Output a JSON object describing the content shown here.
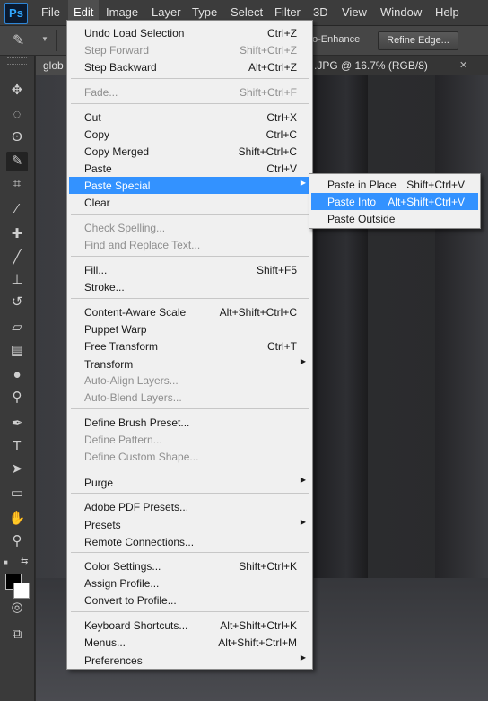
{
  "app": {
    "logo": "Ps"
  },
  "menubar": {
    "items": [
      {
        "label": "File"
      },
      {
        "label": "Edit"
      },
      {
        "label": "Image"
      },
      {
        "label": "Layer"
      },
      {
        "label": "Type"
      },
      {
        "label": "Select"
      },
      {
        "label": "Filter"
      },
      {
        "label": "3D"
      },
      {
        "label": "View"
      },
      {
        "label": "Window"
      },
      {
        "label": "Help"
      }
    ]
  },
  "options_bar": {
    "auto_enhance_label": "o-Enhance",
    "refine_edge_label": "Refine Edge..."
  },
  "tabs": {
    "left_label": "glob",
    "right_label": ".JPG @ 16.7% (RGB/8)",
    "close_glyph": "✕"
  },
  "edit_menu": {
    "items": [
      {
        "label": "Undo Load Selection",
        "shortcut": "Ctrl+Z"
      },
      {
        "label": "Step Forward",
        "shortcut": "Shift+Ctrl+Z",
        "disabled": true
      },
      {
        "label": "Step Backward",
        "shortcut": "Alt+Ctrl+Z"
      },
      {
        "label": "Fade...",
        "shortcut": "Shift+Ctrl+F",
        "disabled": true
      },
      {
        "label": "Cut",
        "shortcut": "Ctrl+X"
      },
      {
        "label": "Copy",
        "shortcut": "Ctrl+C"
      },
      {
        "label": "Copy Merged",
        "shortcut": "Shift+Ctrl+C"
      },
      {
        "label": "Paste",
        "shortcut": "Ctrl+V"
      },
      {
        "label": "Paste Special",
        "shortcut": "",
        "submenu": true,
        "highlighted": true
      },
      {
        "label": "Clear",
        "shortcut": ""
      },
      {
        "label": "Check Spelling...",
        "shortcut": "",
        "disabled": true
      },
      {
        "label": "Find and Replace Text...",
        "shortcut": "",
        "disabled": true
      },
      {
        "label": "Fill...",
        "shortcut": "Shift+F5"
      },
      {
        "label": "Stroke...",
        "shortcut": ""
      },
      {
        "label": "Content-Aware Scale",
        "shortcut": "Alt+Shift+Ctrl+C"
      },
      {
        "label": "Puppet Warp",
        "shortcut": ""
      },
      {
        "label": "Free Transform",
        "shortcut": "Ctrl+T"
      },
      {
        "label": "Transform",
        "shortcut": "",
        "submenu": true
      },
      {
        "label": "Auto-Align Layers...",
        "shortcut": "",
        "disabled": true
      },
      {
        "label": "Auto-Blend Layers...",
        "shortcut": "",
        "disabled": true
      },
      {
        "label": "Define Brush Preset...",
        "shortcut": ""
      },
      {
        "label": "Define Pattern...",
        "shortcut": "",
        "disabled": true
      },
      {
        "label": "Define Custom Shape...",
        "shortcut": "",
        "disabled": true
      },
      {
        "label": "Purge",
        "shortcut": "",
        "submenu": true
      },
      {
        "label": "Adobe PDF Presets...",
        "shortcut": ""
      },
      {
        "label": "Presets",
        "shortcut": "",
        "submenu": true
      },
      {
        "label": "Remote Connections...",
        "shortcut": ""
      },
      {
        "label": "Color Settings...",
        "shortcut": "Shift+Ctrl+K"
      },
      {
        "label": "Assign Profile...",
        "shortcut": ""
      },
      {
        "label": "Convert to Profile...",
        "shortcut": ""
      },
      {
        "label": "Keyboard Shortcuts...",
        "shortcut": "Alt+Shift+Ctrl+K"
      },
      {
        "label": "Menus...",
        "shortcut": "Alt+Shift+Ctrl+M"
      },
      {
        "label": "Preferences",
        "shortcut": "",
        "submenu": true
      }
    ]
  },
  "paste_special_menu": {
    "items": [
      {
        "label": "Paste in Place",
        "shortcut": "Shift+Ctrl+V"
      },
      {
        "label": "Paste Into",
        "shortcut": "Alt+Shift+Ctrl+V",
        "highlighted": true
      },
      {
        "label": "Paste Outside",
        "shortcut": ""
      }
    ]
  },
  "tools": [
    {
      "name": "move-tool-icon",
      "glyph": "✥"
    },
    {
      "name": "marquee-tool-icon",
      "glyph": "◌"
    },
    {
      "name": "lasso-tool-icon",
      "glyph": "ʘ"
    },
    {
      "name": "quick-selection-tool-icon",
      "glyph": "✎",
      "selected": true
    },
    {
      "name": "crop-tool-icon",
      "glyph": "⌗"
    },
    {
      "name": "eyedropper-tool-icon",
      "glyph": "⁄"
    },
    {
      "name": "healing-brush-tool-icon",
      "glyph": "✚"
    },
    {
      "name": "brush-tool-icon",
      "glyph": "╱"
    },
    {
      "name": "clone-stamp-tool-icon",
      "glyph": "⊥"
    },
    {
      "name": "history-brush-tool-icon",
      "glyph": "↺"
    },
    {
      "name": "eraser-tool-icon",
      "glyph": "▱"
    },
    {
      "name": "gradient-tool-icon",
      "glyph": "▤"
    },
    {
      "name": "blur-tool-icon",
      "glyph": "●"
    },
    {
      "name": "dodge-tool-icon",
      "glyph": "⚲"
    },
    {
      "name": "pen-tool-icon",
      "glyph": "✒"
    },
    {
      "name": "type-tool-icon",
      "glyph": "T"
    },
    {
      "name": "path-selection-tool-icon",
      "glyph": "➤"
    },
    {
      "name": "shape-tool-icon",
      "glyph": "▭"
    },
    {
      "name": "hand-tool-icon",
      "glyph": "✋"
    },
    {
      "name": "zoom-tool-icon",
      "glyph": "⚲"
    },
    {
      "name": "quick-mask-icon",
      "glyph": "◎"
    },
    {
      "name": "screen-mode-icon",
      "glyph": "⧉"
    }
  ],
  "colors": {
    "highlight": "#3392ff",
    "menu_bg": "#f0f0f0",
    "foreground_color": "#000000",
    "background_color": "#ffffff"
  }
}
